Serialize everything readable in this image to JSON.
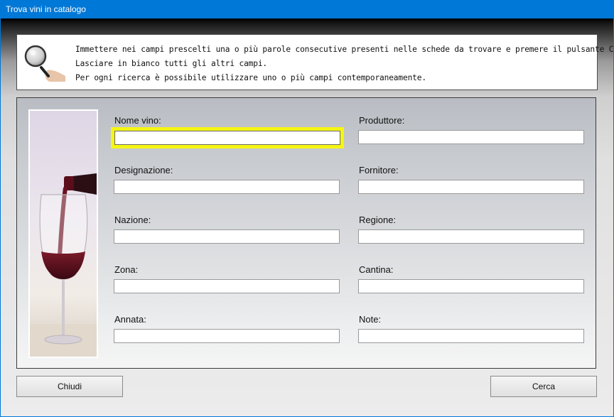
{
  "window": {
    "title": "Trova vini in catalogo"
  },
  "info": {
    "lines": [
      "Immettere nei campi prescelti una o più parole consecutive presenti nelle schede da trovare e premere il pulsante Cerca.",
      "Lasciare in bianco tutti gli altri campi.",
      "Per ogni ricerca è possibile utilizzare uno o più campi contemporaneamente."
    ]
  },
  "fields": {
    "nome_vino": {
      "label": "Nome vino:",
      "value": ""
    },
    "produttore": {
      "label": "Produttore:",
      "value": ""
    },
    "designazione": {
      "label": "Designazione:",
      "value": ""
    },
    "fornitore": {
      "label": "Fornitore:",
      "value": ""
    },
    "nazione": {
      "label": "Nazione:",
      "value": ""
    },
    "regione": {
      "label": "Regione:",
      "value": ""
    },
    "zona": {
      "label": "Zona:",
      "value": ""
    },
    "cantina": {
      "label": "Cantina:",
      "value": ""
    },
    "annata": {
      "label": "Annata:",
      "value": ""
    },
    "note": {
      "label": "Note:",
      "value": ""
    }
  },
  "buttons": {
    "close": "Chiudi",
    "search": "Cerca"
  },
  "colors": {
    "titlebar": "#0078d7",
    "focus_highlight": "#f5f514",
    "wine": "#5a0f1e"
  }
}
